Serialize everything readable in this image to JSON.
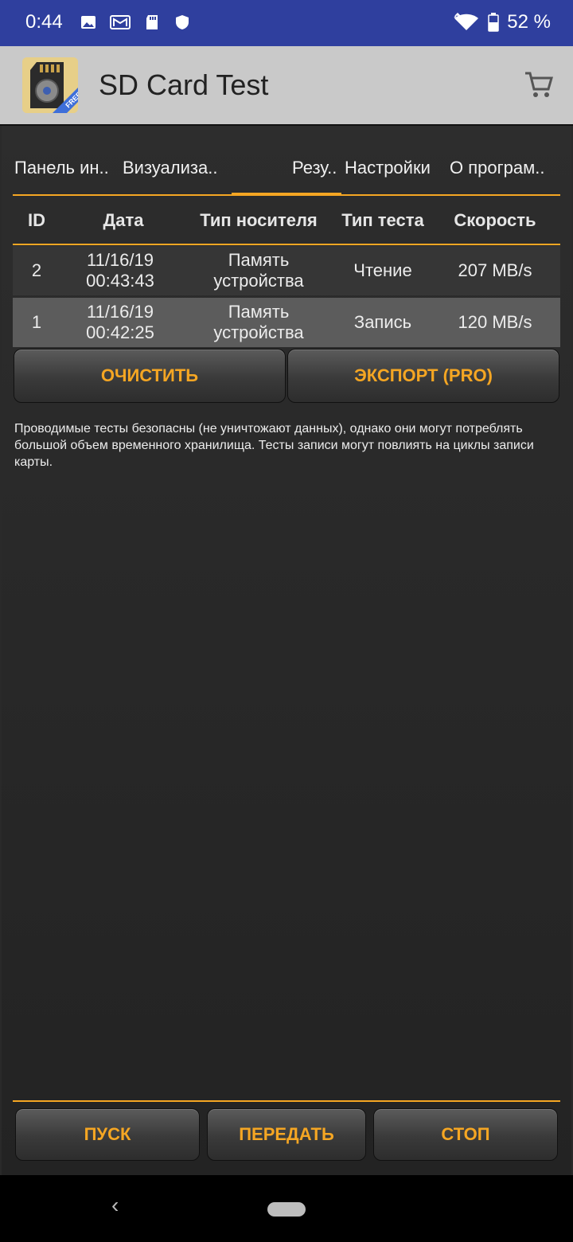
{
  "status_bar": {
    "time": "0:44",
    "battery": "52 %"
  },
  "app_bar": {
    "title": "SD Card Test",
    "logo_badge": "FREE"
  },
  "tabs": [
    {
      "label": "Панель ин.."
    },
    {
      "label": "Визуализа.."
    },
    {
      "label": "Резу.."
    },
    {
      "label": "Настройки"
    },
    {
      "label": "О програм.."
    }
  ],
  "table": {
    "headers": [
      "ID",
      "Дата",
      "Тип носителя",
      "Тип теста",
      "Скорость"
    ],
    "rows": [
      {
        "id": "2",
        "date_line1": "11/16/19",
        "date_line2": "00:43:43",
        "media_line1": "Память",
        "media_line2": "устройства",
        "test": "Чтение",
        "speed": "207 MB/s"
      },
      {
        "id": "1",
        "date_line1": "11/16/19",
        "date_line2": "00:42:25",
        "media_line1": "Память",
        "media_line2": "устройства",
        "test": "Запись",
        "speed": "120 MB/s"
      }
    ]
  },
  "buttons": {
    "clear": "ОЧИСТИТЬ",
    "export": "ЭКСПОРТ (PRO)",
    "start": "ПУСК",
    "send": "ПЕРЕДАТЬ",
    "stop": "СТОП"
  },
  "note": "Проводимые тесты безопасны (не уничтожают данных), однако они могут потреблять большой объем временного хранилища. Тесты записи могут повлиять на циклы записи карты.",
  "colors": {
    "accent": "#f5a623",
    "status_bar": "#2f3f9e",
    "app_bar": "#c9c9c9"
  }
}
